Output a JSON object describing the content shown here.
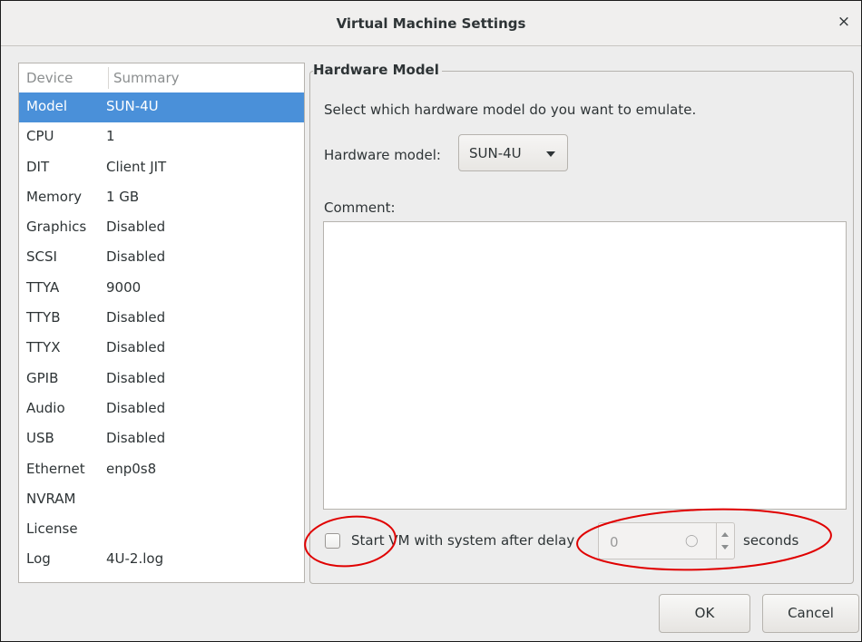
{
  "window": {
    "title": "Virtual Machine Settings",
    "close_glyph": "×"
  },
  "device_list": {
    "columns": [
      "Device",
      "Summary"
    ],
    "selected_index": 0,
    "rows": [
      {
        "device": "Model",
        "summary": "SUN-4U"
      },
      {
        "device": "CPU",
        "summary": "1"
      },
      {
        "device": "DIT",
        "summary": "Client JIT"
      },
      {
        "device": "Memory",
        "summary": "1 GB"
      },
      {
        "device": "Graphics",
        "summary": "Disabled"
      },
      {
        "device": "SCSI",
        "summary": "Disabled"
      },
      {
        "device": "TTYA",
        "summary": "9000"
      },
      {
        "device": "TTYB",
        "summary": "Disabled"
      },
      {
        "device": "TTYX",
        "summary": "Disabled"
      },
      {
        "device": "GPIB",
        "summary": "Disabled"
      },
      {
        "device": "Audio",
        "summary": "Disabled"
      },
      {
        "device": "USB",
        "summary": "Disabled"
      },
      {
        "device": "Ethernet",
        "summary": "enp0s8"
      },
      {
        "device": "NVRAM",
        "summary": ""
      },
      {
        "device": "License",
        "summary": ""
      },
      {
        "device": "Log",
        "summary": "4U-2.log"
      }
    ]
  },
  "hardware": {
    "group_title": "Hardware Model",
    "description": "Select which hardware model do you want to emulate.",
    "model_label": "Hardware model:",
    "model_value": "SUN-4U",
    "comment_label": "Comment:",
    "comment_value": "",
    "autostart_label": "Start VM with system after delay",
    "autostart_checked": false,
    "delay_value": "0",
    "delay_icon": "lightbulb-icon",
    "delay_unit": "seconds"
  },
  "buttons": {
    "ok": "OK",
    "cancel": "Cancel"
  },
  "colors": {
    "selection": "#4a90d9",
    "annotation": "#e00000"
  }
}
